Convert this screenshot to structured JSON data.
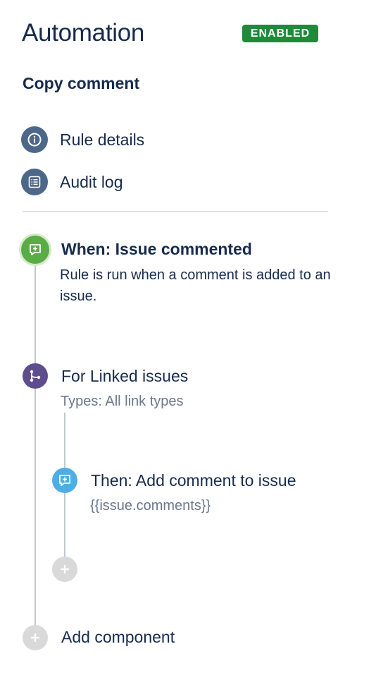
{
  "header": {
    "title": "Automation",
    "status_badge": "ENABLED"
  },
  "rule": {
    "name": "Copy comment"
  },
  "nav": {
    "items": [
      {
        "label": "Rule details",
        "icon": "info-icon"
      },
      {
        "label": "Audit log",
        "icon": "list-icon"
      }
    ]
  },
  "flow": {
    "trigger": {
      "title": "When: Issue commented",
      "description": "Rule is run when a comment is added to an issue.",
      "icon": "comment-add-icon",
      "color": "#5AAC44"
    },
    "branch": {
      "title": "For Linked issues",
      "subtitle": "Types: All link types",
      "icon": "branch-icon",
      "color": "#5E4D8C"
    },
    "action": {
      "title": "Then: Add comment to issue",
      "subtitle": "{{issue.comments}}",
      "icon": "comment-add-icon",
      "color": "#4FADE6"
    },
    "add_component_label": "Add component"
  },
  "colors": {
    "text": "#172B4D",
    "secondary_text": "#6B778C",
    "badge": "#1F8A3A",
    "nav_icon_bg": "#4C6788",
    "connector": "#C1C7D0",
    "add_node": "#D9D9D9"
  }
}
